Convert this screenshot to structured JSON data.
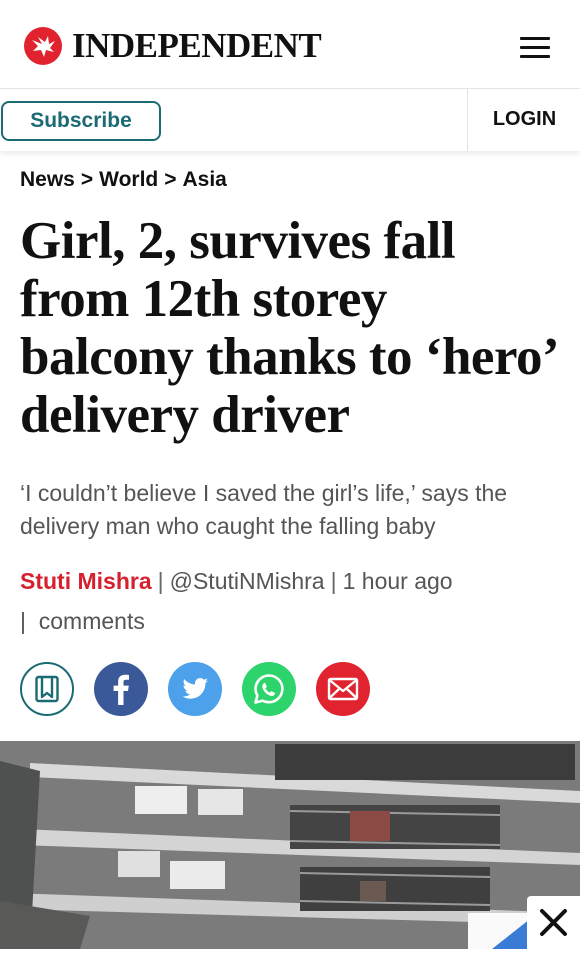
{
  "header": {
    "brand": "INDEPENDENT",
    "logo_icon": "eagle-logo-icon",
    "menu_icon": "hamburger-menu-icon"
  },
  "subbar": {
    "subscribe_label": "Subscribe",
    "login_label": "LOGIN"
  },
  "breadcrumb": {
    "items": [
      "News",
      "World",
      "Asia"
    ],
    "separator": ">"
  },
  "article": {
    "headline": "Girl, 2, survives fall from 12th storey balcony thanks to ‘hero’ delivery driver",
    "standfirst": "‘I couldn’t believe I saved the girl’s life,’ says the delivery man who caught the falling baby",
    "author": "Stuti Mishra",
    "twitter_handle": "@StutiNMishra",
    "time": "1 hour ago",
    "comments_label": "comments",
    "comments_pipe": "|"
  },
  "share": {
    "icons": [
      "bookmark-icon",
      "facebook-icon",
      "twitter-icon",
      "whatsapp-icon",
      "email-icon"
    ]
  },
  "colors": {
    "brand_red": "#e0232e",
    "teal": "#1b6b73",
    "facebook": "#3b5998",
    "twitter": "#4da1ea",
    "whatsapp": "#2cd46b"
  }
}
